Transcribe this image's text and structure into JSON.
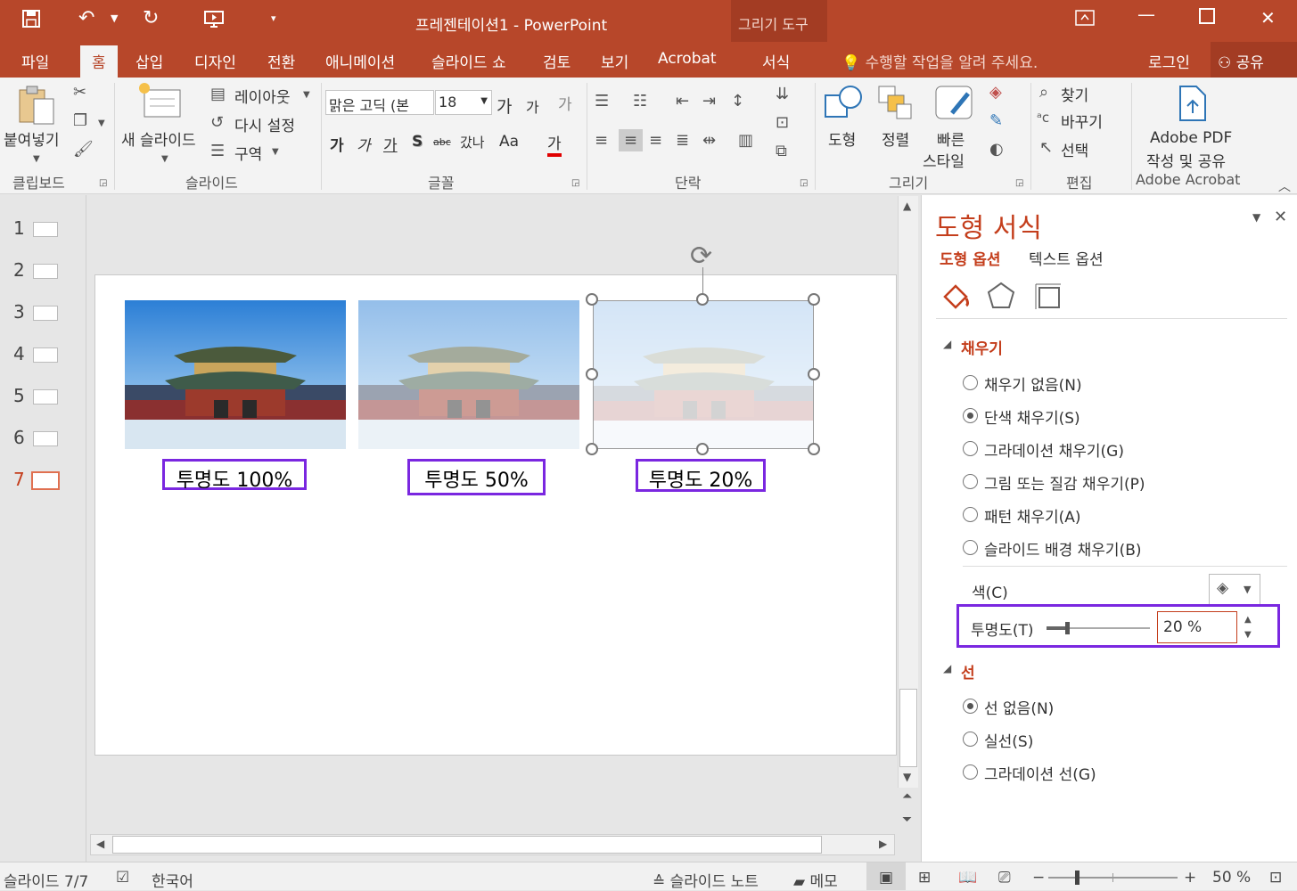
{
  "app": {
    "title": "프레젠테이션1 - PowerPoint",
    "context_group": "그리기 도구"
  },
  "tabs": [
    "파일",
    "홈",
    "삽입",
    "디자인",
    "전환",
    "애니메이션",
    "슬라이드 쇼",
    "검토",
    "보기",
    "Acrobat",
    "서식"
  ],
  "tell_me": "수행할 작업을 알려 주세요.",
  "account": {
    "signin": "로그인",
    "share": "공유"
  },
  "ribbon": {
    "clipboard": {
      "paste": "붙여넣기",
      "group": "클립보드"
    },
    "slides": {
      "new_slide": "새 슬라이드",
      "layout": "레이아웃",
      "reset": "다시 설정",
      "section": "구역",
      "group": "슬라이드"
    },
    "font": {
      "name": "맑은 고딕 (본",
      "size": "18",
      "bold": "가",
      "italic": "가",
      "underline": "가",
      "shadow": "S",
      "strike": "abc",
      "spacing": "갔나",
      "case": "Aa",
      "color": "가",
      "grow": "가",
      "shrink": "가",
      "clear": "가",
      "group": "글꼴"
    },
    "paragraph": {
      "group": "단락"
    },
    "drawing": {
      "shape": "도형",
      "arrange": "정렬",
      "quick_style_1": "빠른",
      "quick_style_2": "스타일",
      "group": "그리기"
    },
    "editing": {
      "find": "찾기",
      "replace": "바꾸기",
      "select": "선택",
      "group": "편집"
    },
    "acrobat": {
      "label_1": "Adobe PDF",
      "label_2": "작성 및 공유",
      "group": "Adobe Acrobat"
    }
  },
  "thumbnails": [
    "1",
    "2",
    "3",
    "4",
    "5",
    "6",
    "7"
  ],
  "selected_slide": 7,
  "slide": {
    "labels": [
      "투명도 100%",
      "투명도 50%",
      "투명도 20%"
    ],
    "image_opacity": [
      1.0,
      0.5,
      0.2
    ]
  },
  "pane": {
    "title": "도형 서식",
    "tab_shape": "도형 옵션",
    "tab_text": "텍스트 옵션",
    "fill_section": "채우기",
    "fill_options": [
      "채우기 없음(N)",
      "단색 채우기(S)",
      "그라데이션 채우기(G)",
      "그림 또는 질감 채우기(P)",
      "패턴 채우기(A)",
      "슬라이드 배경 채우기(B)"
    ],
    "fill_selected": 1,
    "color_label": "색(C)",
    "transparency_label": "투명도(T)",
    "transparency_value": "20 %",
    "transparency_level": 0.2,
    "line_section": "선",
    "line_options": [
      "선 없음(N)",
      "실선(S)",
      "그라데이션 선(G)"
    ],
    "line_selected": 0
  },
  "status": {
    "slide": "슬라이드 7/7",
    "language": "한국어",
    "notes": "슬라이드 노트",
    "comments": "메모",
    "zoom": "50 %"
  },
  "colors": {
    "accent": "#b7472a",
    "highlight": "#7a27e0"
  }
}
